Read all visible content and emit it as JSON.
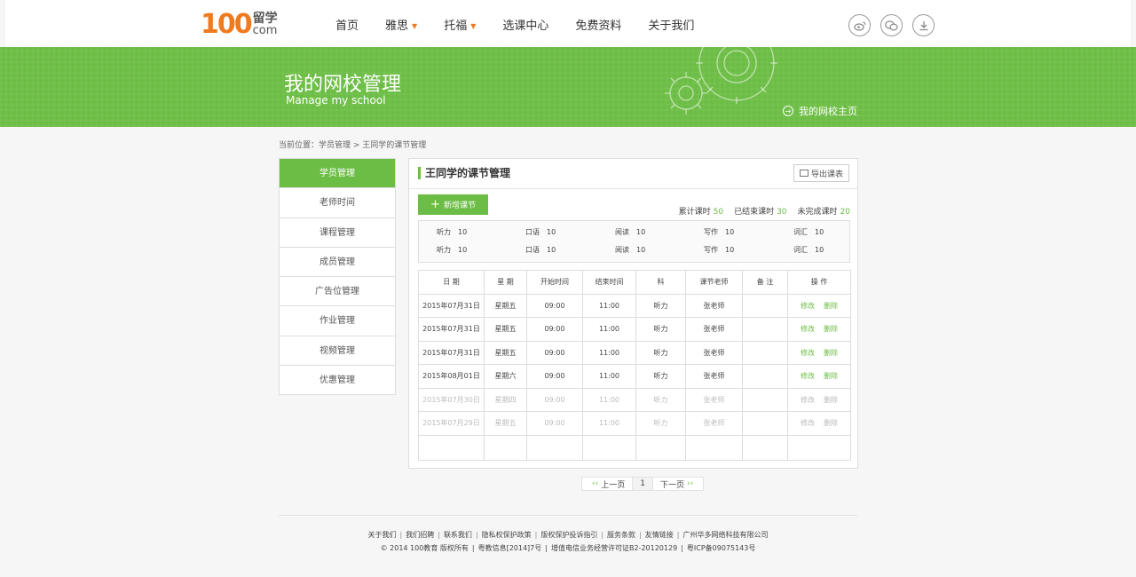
{
  "logo": {
    "number": "100",
    "cn": "留学",
    "com": "com"
  },
  "nav": [
    {
      "label": "首页",
      "has_caret": false
    },
    {
      "label": "雅思",
      "has_caret": true
    },
    {
      "label": "托福",
      "has_caret": true
    },
    {
      "label": "选课中心",
      "has_caret": false
    },
    {
      "label": "免费资料",
      "has_caret": false
    },
    {
      "label": "关于我们",
      "has_caret": false
    }
  ],
  "header_icons": [
    "weibo-icon",
    "wechat-icon",
    "download-icon"
  ],
  "banner": {
    "title": "我的网校管理",
    "subtitle": "Manage my school",
    "link": "我的网校主页"
  },
  "breadcrumb": "当前位置：学员管理 > 王同学的课节管理",
  "sidebar": [
    {
      "label": "学员管理",
      "active": true
    },
    {
      "label": "老师时间",
      "active": false
    },
    {
      "label": "课程管理",
      "active": false
    },
    {
      "label": "成员管理",
      "active": false
    },
    {
      "label": "广告位管理",
      "active": false
    },
    {
      "label": "作业管理",
      "active": false
    },
    {
      "label": "视频管理",
      "active": false
    },
    {
      "label": "优惠管理",
      "active": false
    }
  ],
  "panel": {
    "title": "王同学的课节管理",
    "export_label": "导出课表",
    "add_label": "新增课节",
    "stats": [
      {
        "label": "累计课时",
        "value": "50"
      },
      {
        "label": "已结束课时",
        "value": "30"
      },
      {
        "label": "未完成课时",
        "value": "20"
      }
    ],
    "summary": [
      [
        {
          "k": "听力",
          "v": "10"
        },
        {
          "k": "口语",
          "v": "10"
        },
        {
          "k": "阅读",
          "v": "10"
        },
        {
          "k": "写作",
          "v": "10"
        },
        {
          "k": "词汇",
          "v": "10"
        }
      ],
      [
        {
          "k": "听力",
          "v": "10"
        },
        {
          "k": "口语",
          "v": "10"
        },
        {
          "k": "阅读",
          "v": "10"
        },
        {
          "k": "写作",
          "v": "10"
        },
        {
          "k": "词汇",
          "v": "10"
        }
      ]
    ],
    "columns": [
      "日 期",
      "星 期",
      "开始时间",
      "结束时间",
      "科",
      "课节老师",
      "备 注",
      "操 作"
    ],
    "rows": [
      {
        "date": "2015年07月31日",
        "week": "星期五",
        "start": "09:00",
        "end": "11:00",
        "subject": "听力",
        "teacher": "张老师",
        "note": "",
        "muted": false
      },
      {
        "date": "2015年07月31日",
        "week": "星期五",
        "start": "09:00",
        "end": "11:00",
        "subject": "听力",
        "teacher": "张老师",
        "note": "",
        "muted": false
      },
      {
        "date": "2015年07月31日",
        "week": "星期五",
        "start": "09:00",
        "end": "11:00",
        "subject": "听力",
        "teacher": "张老师",
        "note": "",
        "muted": false
      },
      {
        "date": "2015年08月01日",
        "week": "星期六",
        "start": "09:00",
        "end": "11:00",
        "subject": "听力",
        "teacher": "张老师",
        "note": "",
        "muted": false
      },
      {
        "date": "2015年07月30日",
        "week": "星期四",
        "start": "09:00",
        "end": "11:00",
        "subject": "听力",
        "teacher": "张老师",
        "note": "",
        "muted": true
      },
      {
        "date": "2015年07月29日",
        "week": "星期五",
        "start": "09:00",
        "end": "11:00",
        "subject": "听力",
        "teacher": "张老师",
        "note": "",
        "muted": true
      }
    ],
    "edit_label": "修改",
    "delete_label": "删除"
  },
  "pager": {
    "prev": "上一页",
    "current": "1",
    "next": "下一页"
  },
  "footer": {
    "links": [
      "关于我们",
      "我们招聘",
      "联系我们",
      "隐私权保护政策",
      "版权保护投诉指引",
      "服务条款",
      "友情链接",
      "广州华多网络科技有限公司"
    ],
    "copy": [
      "© 2014 100教育 版权所有",
      "粤教信息[2014]7号",
      "增值电信业务经营许可证B2-20120129",
      "粤ICP备09075143号"
    ]
  },
  "colors": {
    "brand_green": "#6cbd45",
    "logo_orange": "#f07a1e"
  }
}
